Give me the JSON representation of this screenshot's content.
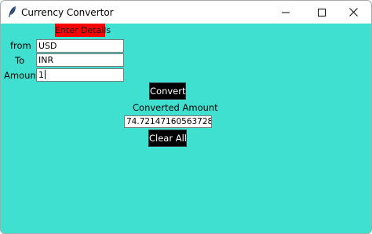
{
  "window": {
    "title": "Currency Convertor",
    "app_icon": "feather-icon",
    "controls": {
      "minimize_icon": "minimize-icon",
      "maximize_icon": "maximize-icon",
      "close_icon": "close-icon"
    }
  },
  "form": {
    "header": "Enter Details",
    "from_label": "from",
    "from_value": "USD",
    "to_label": "To",
    "to_value": "INR",
    "amount_label": "Amount",
    "amount_value": "1",
    "convert_button": "Convert",
    "converted_label": "Converted Amount",
    "converted_value": "74.72147160563728",
    "clear_button": "Clear All"
  },
  "colors": {
    "background": "#40E0D0",
    "header_background": "#FF0000",
    "button_background": "#000000",
    "button_text": "#FFFFFF"
  }
}
